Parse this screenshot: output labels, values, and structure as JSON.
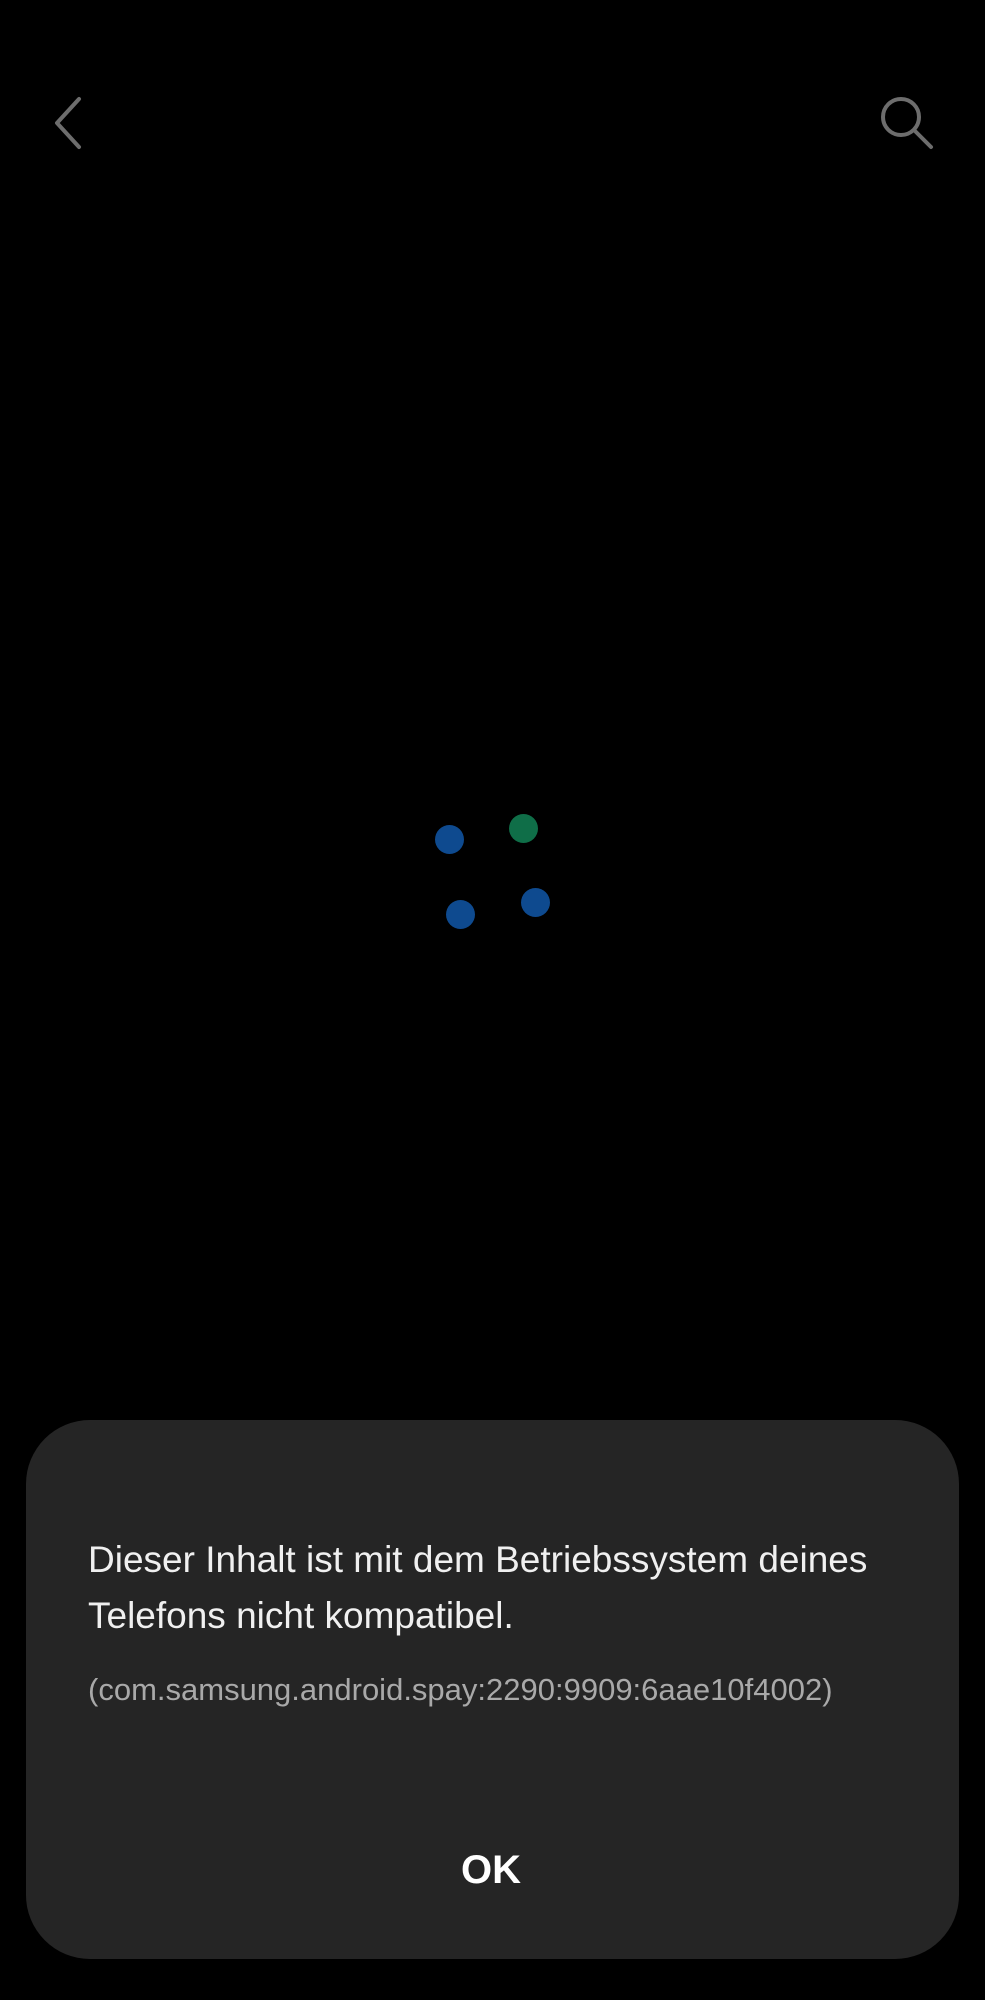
{
  "toolbar": {
    "back_icon": "chevron-left-icon",
    "search_icon": "search-icon"
  },
  "loading": {
    "dot_colors": [
      "#0e4a8f",
      "#0f6e48",
      "#0e4a8f",
      "#0e4a8f"
    ]
  },
  "dialog": {
    "message": "Dieser Inhalt ist mit dem Betriebssystem deines Telefons nicht kompatibel.",
    "code": "(com.samsung.android.spay:2290:9909:6aae10f4002)",
    "ok_label": "OK"
  },
  "colors": {
    "background": "#000000",
    "dialog_background": "#252525",
    "icon_gray": "#6d6d6d"
  }
}
